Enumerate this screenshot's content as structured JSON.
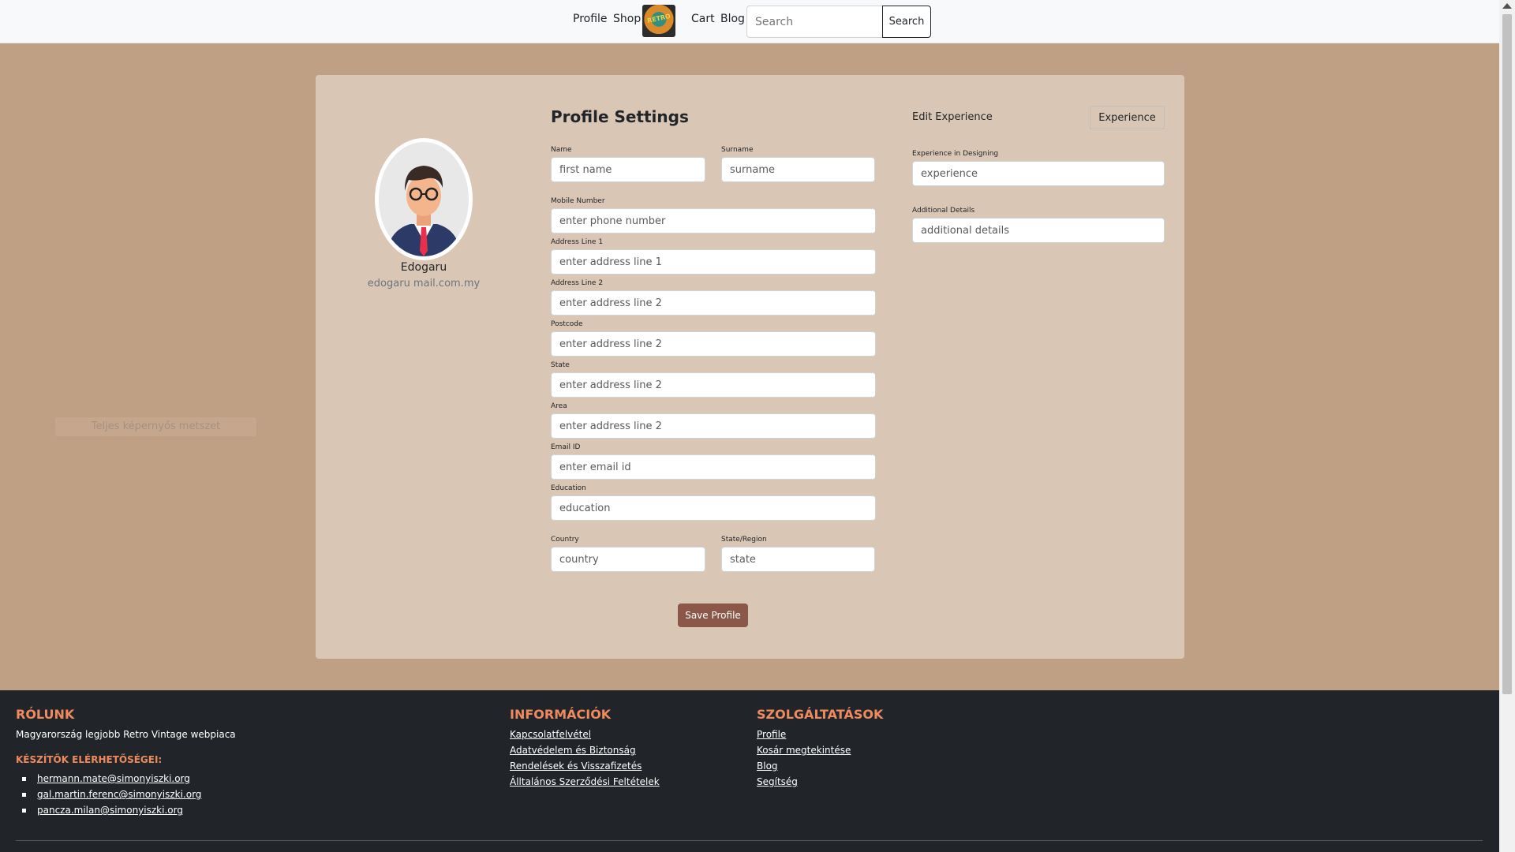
{
  "nav": {
    "links": [
      "Profile",
      "Shop",
      "Cart",
      "Blog"
    ],
    "logo_text": "RETRO",
    "search_placeholder": "Search",
    "search_button": "Search"
  },
  "profile": {
    "name": "Edogaru",
    "email": "edogaru mail.com.my"
  },
  "form": {
    "title": "Profile Settings",
    "name_label": "Name",
    "name_placeholder": "first name",
    "surname_label": "Surname",
    "surname_placeholder": "surname",
    "mobile_label": "Mobile Number",
    "mobile_placeholder": "enter phone number",
    "address1_label": "Address Line 1",
    "address1_placeholder": "enter address line 1",
    "address2_label": "Address Line 2",
    "address2_placeholder": "enter address line 2",
    "postcode_label": "Postcode",
    "postcode_placeholder": "enter address line 2",
    "state_label": "State",
    "state_placeholder": "enter address line 2",
    "area_label": "Area",
    "area_placeholder": "enter address line 2",
    "email_label": "Email ID",
    "email_placeholder": "enter email id",
    "education_label": "Education",
    "education_placeholder": "education",
    "country_label": "Country",
    "country_placeholder": "country",
    "region_label": "State/Region",
    "region_placeholder": "state",
    "save_button": "Save Profile"
  },
  "experience": {
    "edit_label": "Edit Experience",
    "button": "Experience",
    "designing_label": "Experience in Designing",
    "designing_placeholder": "experience",
    "details_label": "Additional Details",
    "details_placeholder": "additional details"
  },
  "floating_button": "Teljes képernyős metszet",
  "footer": {
    "about": {
      "heading": "RÓLUNK",
      "text": "Magyarország legjobb Retro Vintage webpiaca",
      "contacts_heading": "KÉSZÍTŐK ELÉRHETŐSÉGEI:",
      "contacts": [
        "hermann.mate@simonyiszki.org",
        "gal.martin.ferenc@simonyiszki.org",
        "pancza.milan@simonyiszki.org"
      ]
    },
    "info": {
      "heading": "INFORMÁCIÓK",
      "links": [
        "Kapcsolatfelvétel",
        "Adatvédelem és Biztonság",
        "Rendelések és Visszafizetés",
        "Álltalános Szerződési Feltételek"
      ]
    },
    "services": {
      "heading": "SZOLGÁLTATÁSOK",
      "links": [
        "Profile",
        "Kosár megtekintése",
        "Blog",
        "Segítség"
      ]
    }
  },
  "colors": {
    "page_background": "#c0a084",
    "card_background": "#d9c6b5",
    "save_button": "#8b5748",
    "footer_background": "#212529",
    "footer_heading": "#ee8a5d"
  }
}
